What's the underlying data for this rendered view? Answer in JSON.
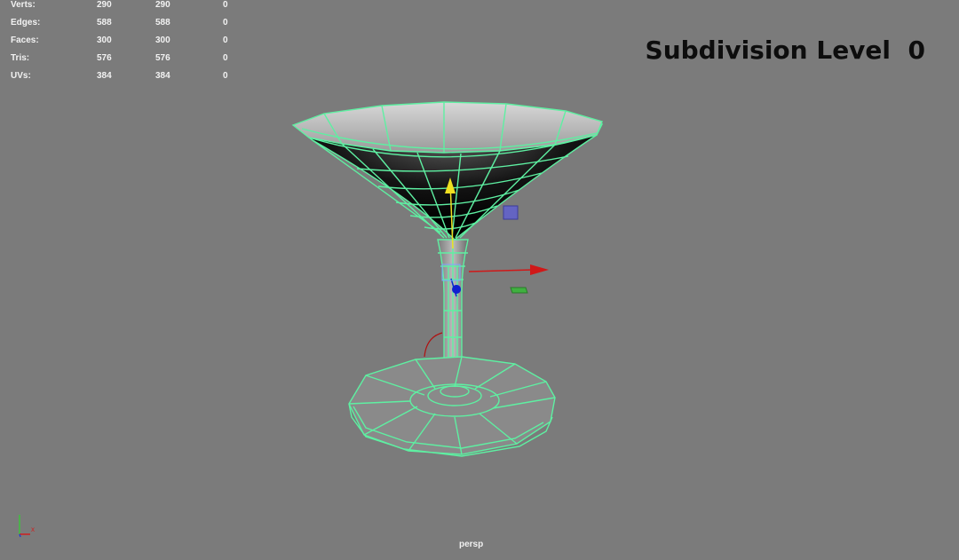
{
  "hud": {
    "rows": [
      {
        "label": "Verts:",
        "v1": "290",
        "v2": "290",
        "v3": "0"
      },
      {
        "label": "Edges:",
        "v1": "588",
        "v2": "588",
        "v3": "0"
      },
      {
        "label": "Faces:",
        "v1": "300",
        "v2": "300",
        "v3": "0"
      },
      {
        "label": "Tris:",
        "v1": "576",
        "v2": "576",
        "v3": "0"
      },
      {
        "label": "UVs:",
        "v1": "384",
        "v2": "384",
        "v3": "0"
      }
    ]
  },
  "overlay": {
    "subdivision_text": "Subdivision Level  0"
  },
  "viewport": {
    "camera": "persp",
    "background_color": "#7b7b7b",
    "wireframe_color": "#5ef0a2"
  },
  "axis_indicator": {
    "x_label": "x"
  },
  "manipulator": {
    "x_axis_color": "#d01818",
    "y_axis_color": "#f0e020",
    "z_axis_color": "#1020d0",
    "plane_handle_color": "#6060d0"
  }
}
